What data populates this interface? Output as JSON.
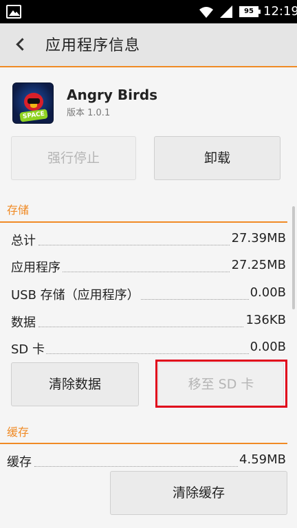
{
  "status_bar": {
    "battery": "95",
    "time": "12:19",
    "icons": [
      "gallery-icon",
      "wifi-icon",
      "signal-icon",
      "battery-icon"
    ]
  },
  "header": {
    "title": "应用程序信息"
  },
  "app": {
    "name": "Angry Birds",
    "version": "版本 1.0.1",
    "icon_label": "SPACE"
  },
  "actions": {
    "force_stop": "强行停止",
    "uninstall": "卸载"
  },
  "storage": {
    "title": "存储",
    "rows": [
      {
        "label": "总计",
        "value": "27.39MB"
      },
      {
        "label": "应用程序",
        "value": "27.25MB"
      },
      {
        "label": "USB 存储（应用程序）",
        "value": "0.00B"
      },
      {
        "label": "数据",
        "value": "136KB"
      },
      {
        "label": "SD 卡",
        "value": "0.00B"
      }
    ],
    "clear_data": "清除数据",
    "move_to_sd": "移至 SD 卡"
  },
  "cache": {
    "title": "缓存",
    "label": "缓存",
    "value": "4.59MB",
    "clear_cache": "清除缓存"
  },
  "colors": {
    "accent": "#f08a24",
    "highlight": "#e0001a"
  }
}
